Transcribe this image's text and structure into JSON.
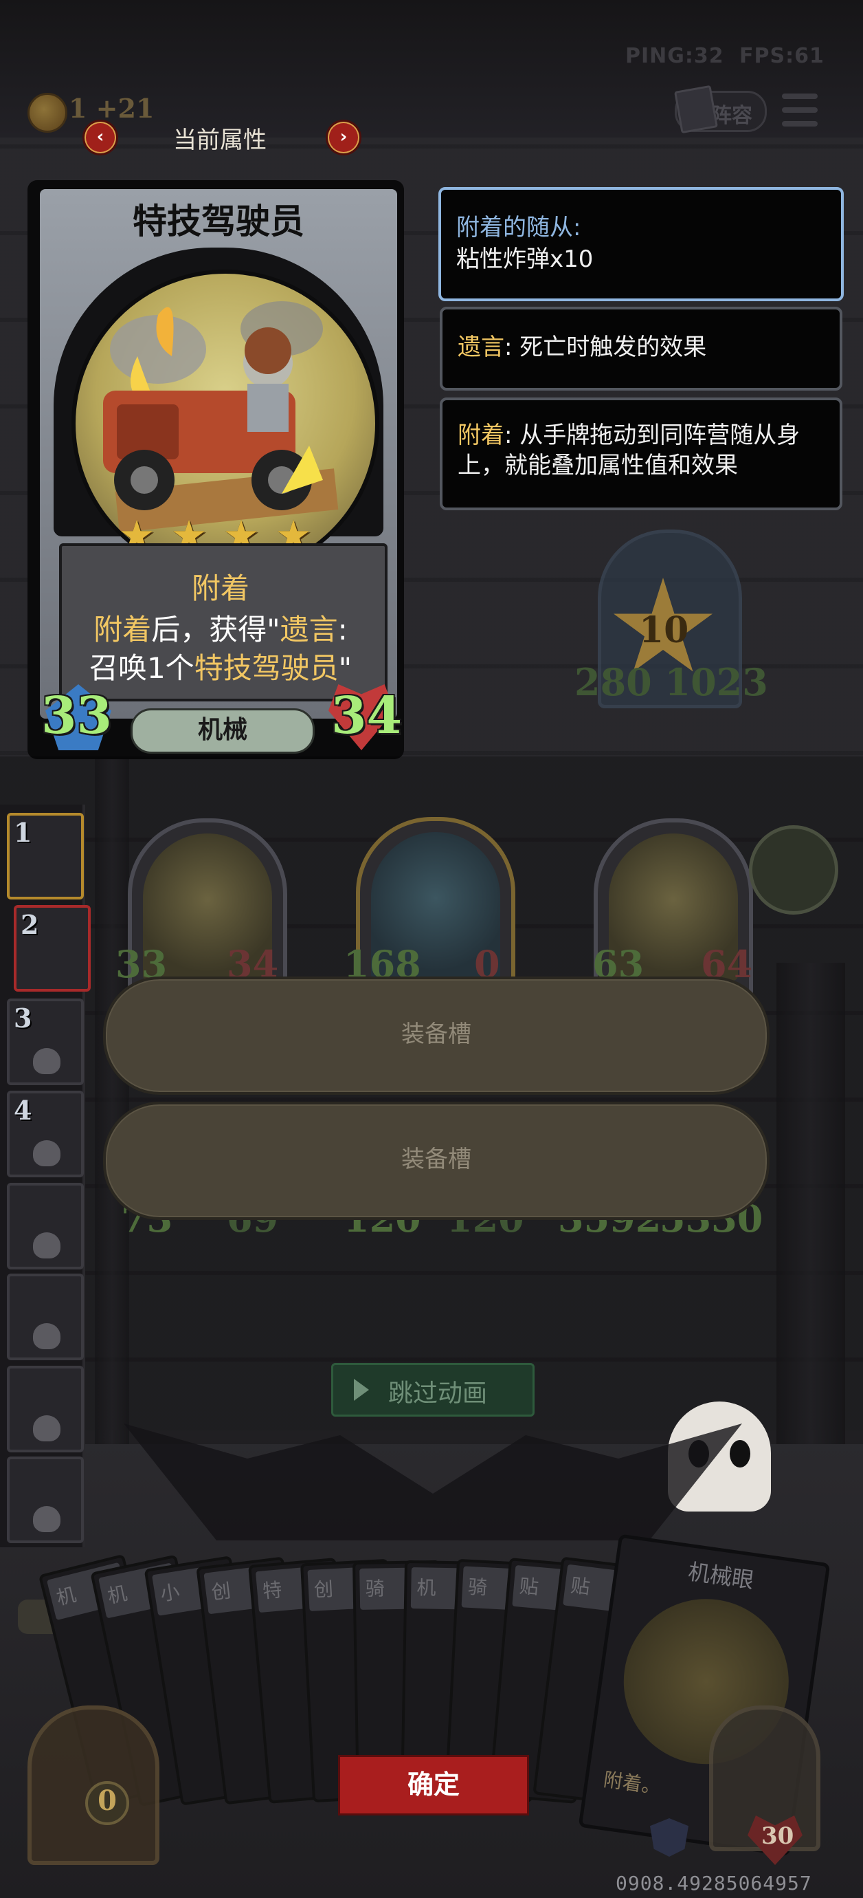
{
  "hud": {
    "ping": "PING:32",
    "fps": "FPS:61",
    "gold": "1 +21",
    "lineup_label": "阵容"
  },
  "attribute_nav": {
    "title": "当前属性",
    "prev_icon": "‹",
    "next_icon": "›"
  },
  "card": {
    "name": "特技驾驶员",
    "stars": 4,
    "keyword": "附着",
    "desc_line1_pre": "附着",
    "desc_line1_mid": "后，获得\"",
    "desc_line1_kw": "遗言",
    "desc_line1_post": ":",
    "desc_line2_pre": "召唤1个",
    "desc_line2_kw": "特技驾驶员",
    "desc_line2_post": "\"",
    "attack": "33",
    "health": "34",
    "tribe": "机械"
  },
  "info_panels": {
    "attached_title": "附着的随从:",
    "attached_value": "粘性炸弹x10",
    "deathrattle_kw": "遗言",
    "deathrattle_text": ": 死亡时触发的效果",
    "attach_kw": "附着",
    "attach_text_1": ": 从手牌拖动到同阵营随从身",
    "attach_text_2": "上，就能叠加属性值和效果"
  },
  "board": {
    "star_level": "10",
    "hero_stats": "280 1023",
    "minions": [
      {
        "atk": "33",
        "hp": "34"
      },
      {
        "atk": "168",
        "hp": "0"
      },
      {
        "atk": "63",
        "hp": "64"
      }
    ],
    "back_row": [
      {
        "atk": "73",
        "hp": "69"
      },
      {
        "atk": "120",
        "hp": "120"
      },
      {
        "atk": "3592",
        "hp": "5330"
      }
    ]
  },
  "equipment_slots": [
    "装备槽",
    "装备槽"
  ],
  "sidebar_slots": [
    "1",
    "2",
    "3",
    "4",
    "",
    "",
    "",
    ""
  ],
  "skip_animation": "跳过动画",
  "hand_cards": [
    "机",
    "机",
    "小",
    "创",
    "特",
    "创",
    "骑",
    "机",
    "骑",
    "贴",
    "贴"
  ],
  "hand_featured": {
    "title": "机械眼",
    "text": "附着。"
  },
  "confirm_label": "确定",
  "counter_left": "0",
  "counter_right": "30",
  "footer_code": "0908.49285064957",
  "colors": {
    "keyword_gold": "#f2c763",
    "stat_green": "#a8ec7a",
    "confirm_red": "#a91e1e",
    "panel_blue": "#8fb6e0"
  }
}
